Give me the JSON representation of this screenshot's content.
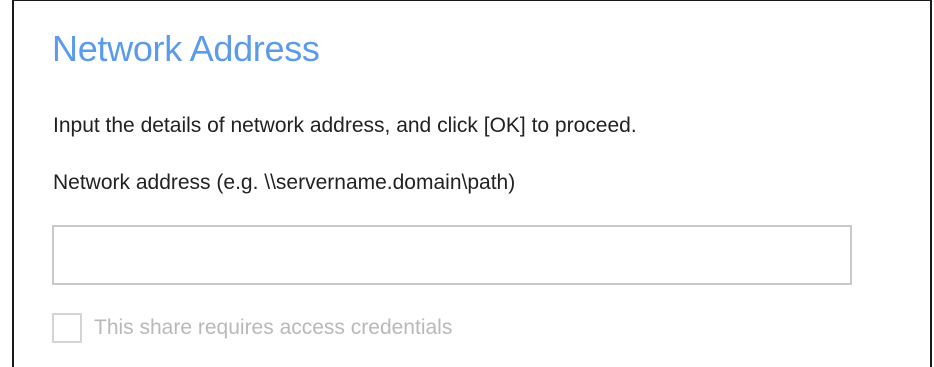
{
  "dialog": {
    "title": "Network Address",
    "instructions": "Input the details of network address, and click [OK] to proceed.",
    "address_label": "Network address (e.g. \\\\servername.domain\\path)",
    "address_value": "",
    "credentials_label": "This share requires access credentials",
    "credentials_checked": false,
    "credentials_enabled": false
  },
  "colors": {
    "title": "#5b9bea",
    "text": "#222222",
    "disabled_text": "#b9b9b9",
    "input_border": "#c9c9c9"
  }
}
